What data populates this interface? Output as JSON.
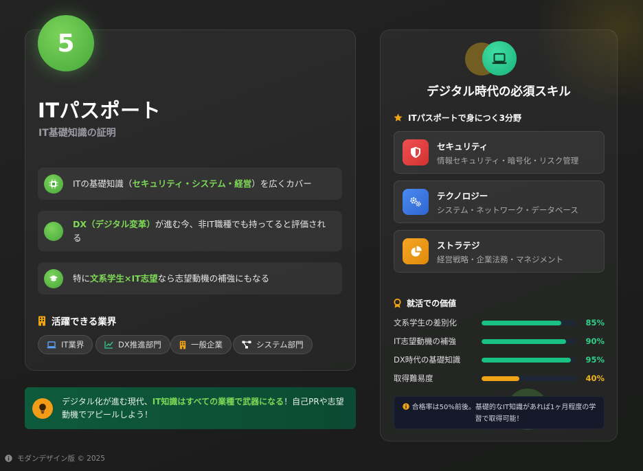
{
  "left": {
    "rank": "5",
    "title": "ITパスポート",
    "subtitle": "IT基礎知識の証明",
    "points": [
      {
        "pre": "ITの基礎知識（",
        "hl": "セキュリティ・システム・経営",
        "post": "）を広くカバー",
        "icon": "chip-icon"
      },
      {
        "pre": "",
        "hl": "DX（デジタル変革）",
        "post": "が進む今、非IT職種でも持ってると評価される",
        "icon": "circle-icon"
      },
      {
        "pre": "特に",
        "hl": "文系学生×IT志望",
        "post": "なら志望動機の補強にもなる",
        "icon": "graduate-icon"
      }
    ],
    "industries_heading": "活躍できる業界",
    "industries": [
      "IT業界",
      "DX推進部門",
      "一般企業",
      "システム部門"
    ]
  },
  "tip": {
    "pre": "デジタル化が進む現代、",
    "hl": "IT知識はすべての業種で武器になる",
    "post": "！自己PRや志望動機でアピールしよう！"
  },
  "footer": "モダンデザイン版 © 2025",
  "right": {
    "title": "デジタル時代の必須スキル",
    "skills_heading": "ITパスポートで身につく3分野",
    "skills": [
      {
        "name": "セキュリティ",
        "desc": "情報セキュリティ・暗号化・リスク管理",
        "color": "#e5413f",
        "icon": "shield-icon"
      },
      {
        "name": "テクノロジー",
        "desc": "システム・ネットワーク・データベース",
        "color": "#3d7be0",
        "icon": "gears-icon"
      },
      {
        "name": "ストラテジ",
        "desc": "経営戦略・企業法務・マネジメント",
        "color": "#f09a18",
        "icon": "pie-chart-icon"
      }
    ],
    "value_heading": "就活での価値",
    "bars": [
      {
        "label": "文系学生の差別化",
        "value": 85,
        "pct": "85%",
        "color": "#19c184"
      },
      {
        "label": "IT志望動機の補強",
        "value": 90,
        "pct": "90%",
        "color": "#19c184"
      },
      {
        "label": "DX時代の基礎知識",
        "value": 95,
        "pct": "95%",
        "color": "#19c184"
      },
      {
        "label": "取得難易度",
        "value": 40,
        "pct": "40%",
        "color": "#f0a415"
      }
    ],
    "note": "合格率は50%前後。基礎的なIT知識があれば1ヶ月程度の学習で取得可能！"
  },
  "colors": {
    "accent_green": "#7ed957",
    "pct_green": "#2fd089",
    "pct_orange": "#f0b41c"
  }
}
